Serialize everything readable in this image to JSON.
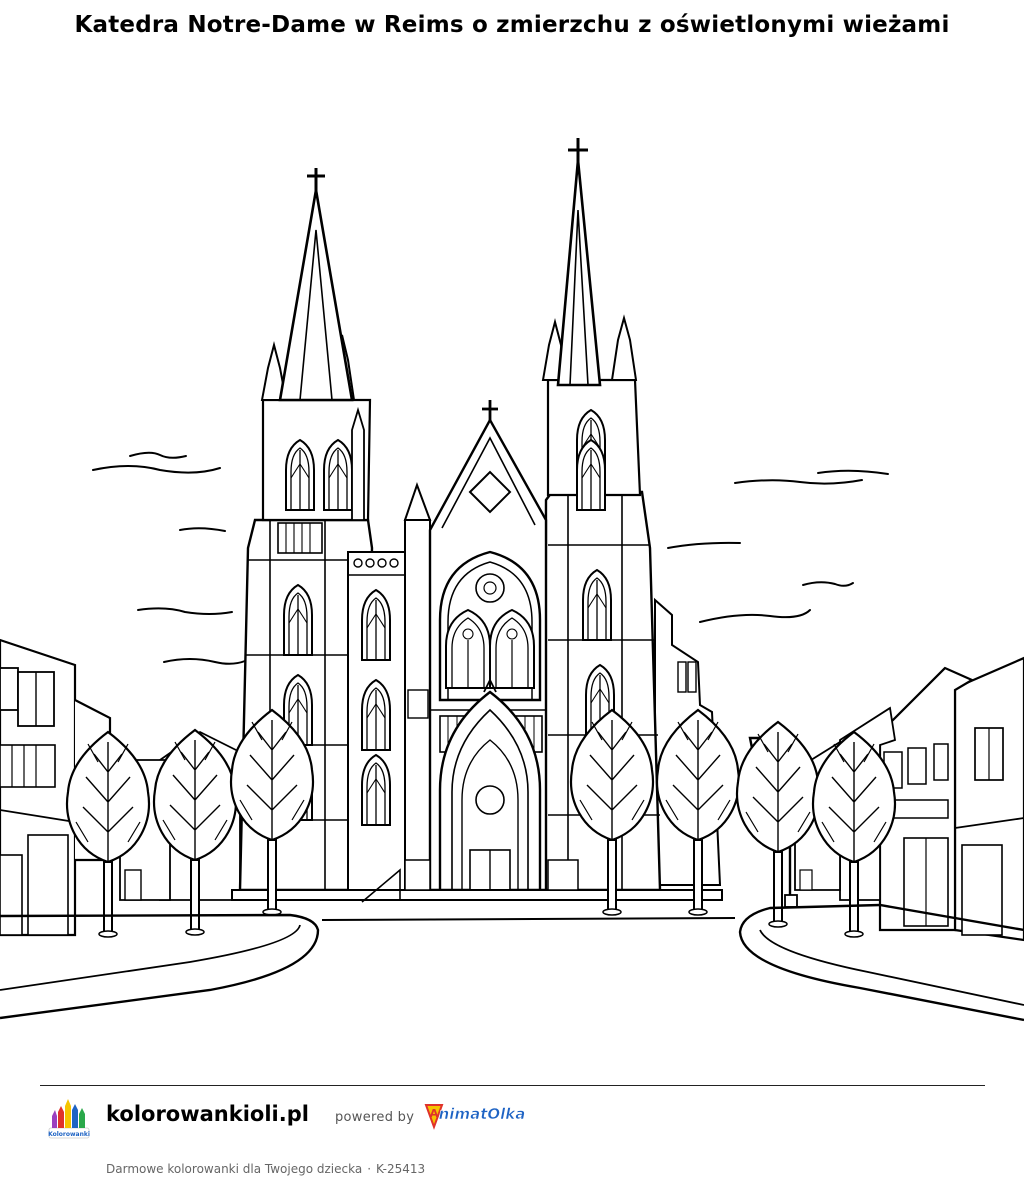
{
  "page": {
    "title": "Katedra Notre-Dame w Reims o zmierzchu z oświetlonymi wieżami"
  },
  "illustration": {
    "subject": "line-art-cathedral-with-two-spires-trees-street"
  },
  "footer": {
    "site_name": "kolorowankioli.pl",
    "powered_by": "powered by",
    "partner_logo_text": "AnimatOlka",
    "site_logo_text": "KolorowankiOli",
    "tagline": "Darmowe kolorowanki dla Twojego dziecka",
    "separator": "·",
    "code": "K-25413"
  },
  "colors": {
    "line": "#000000",
    "background": "#ffffff",
    "partner_blue": "#1e63c4",
    "partner_red": "#e0322b",
    "partner_yellow": "#f5c400"
  }
}
